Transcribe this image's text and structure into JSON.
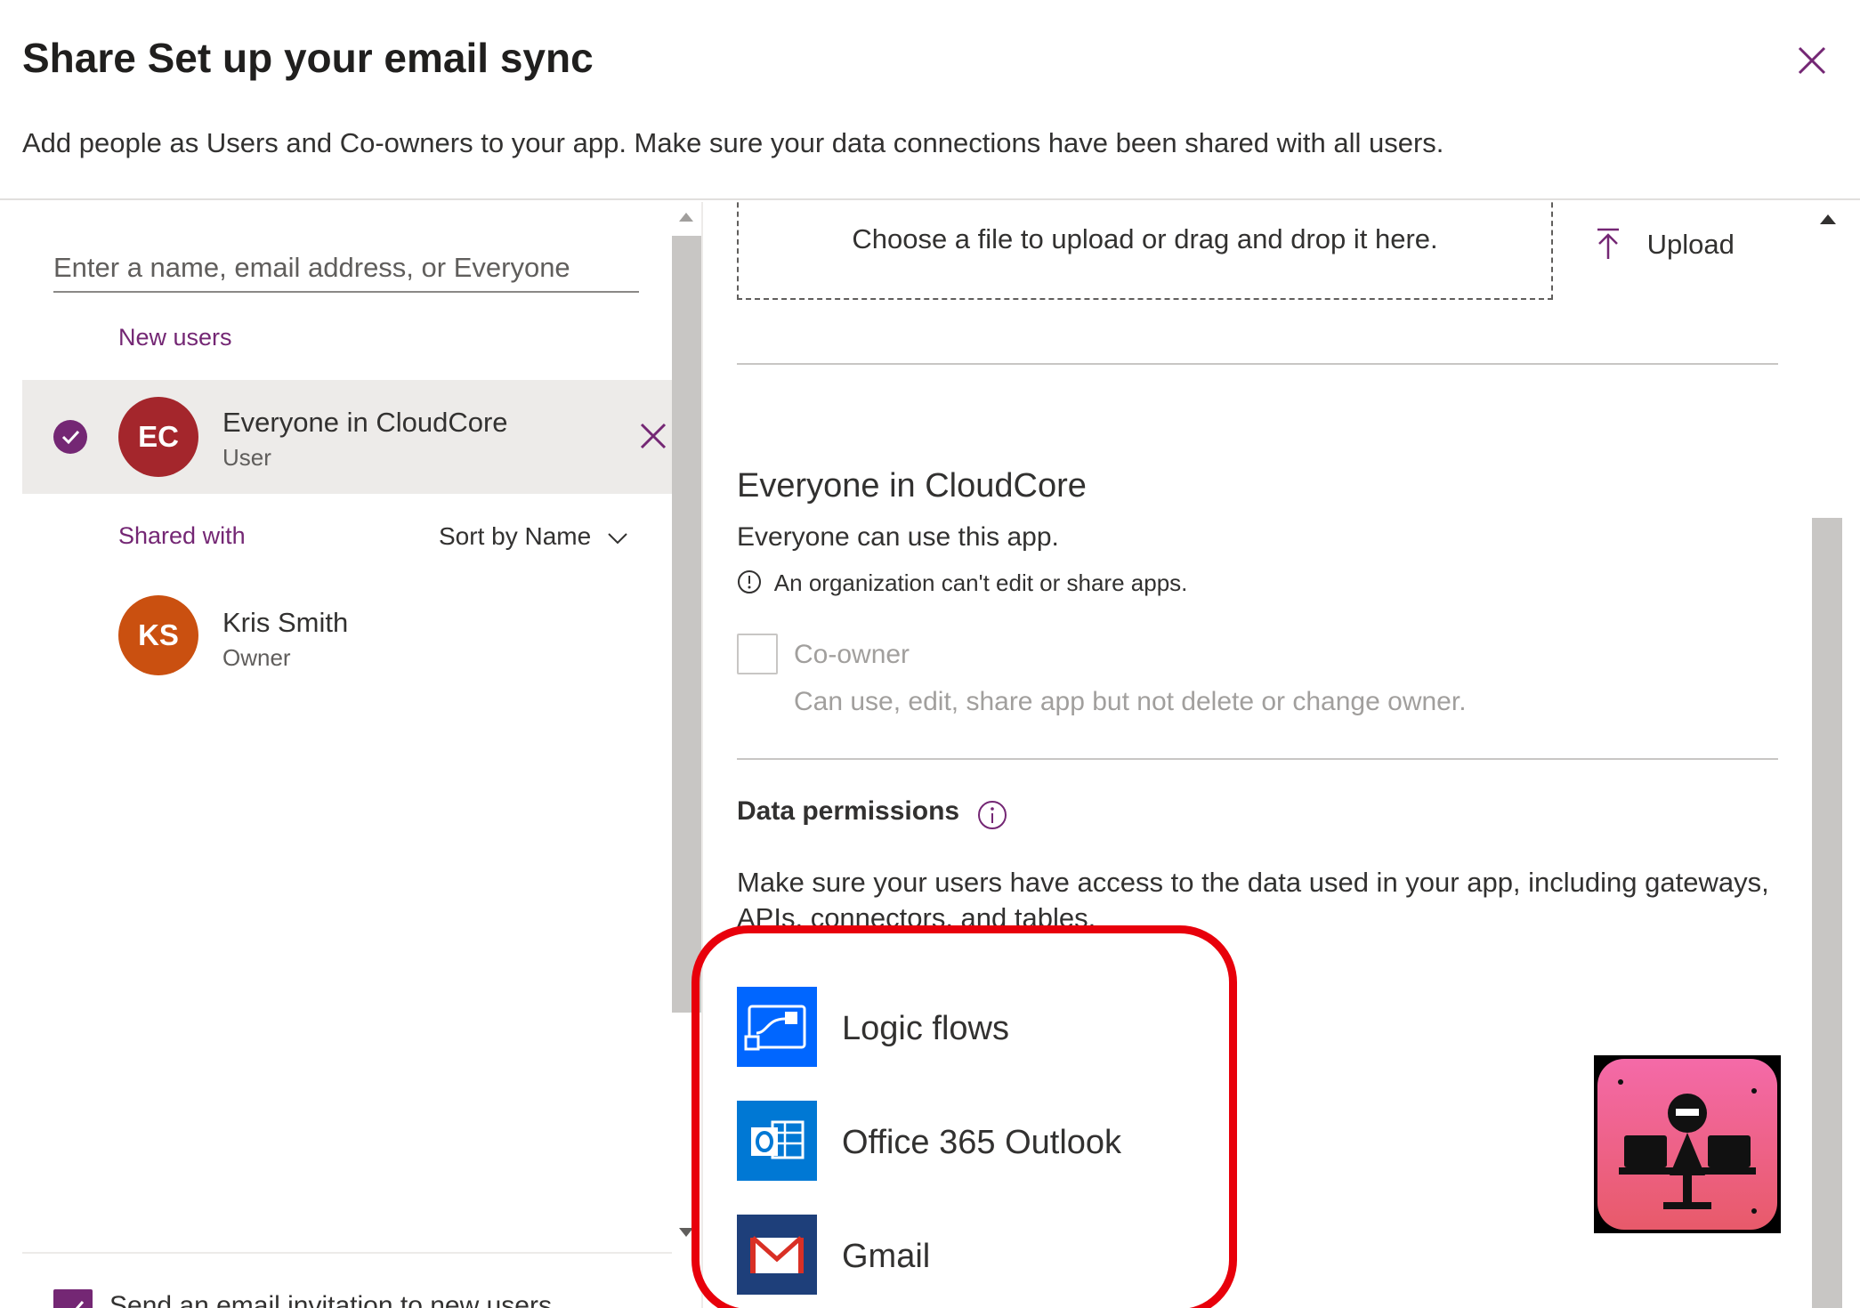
{
  "dialog": {
    "title": "Share Set up your email sync",
    "subtitle": "Add people as Users and Co-owners to your app. Make sure your data connections have been shared with all users.",
    "close_icon": "close-icon"
  },
  "left_pane": {
    "search": {
      "placeholder": "Enter a name, email address, or Everyone",
      "value": ""
    },
    "new_users_label": "New users",
    "new_users": [
      {
        "initials": "EC",
        "name": "Everyone in CloudCore",
        "role": "User",
        "avatar_color": "#a4262c",
        "selected": true
      }
    ],
    "shared_with_label": "Shared with",
    "sort_label": "Sort by Name",
    "shared_with": [
      {
        "initials": "KS",
        "name": "Kris Smith",
        "role": "Owner",
        "avatar_color": "#ca5010"
      }
    ],
    "email_invite_label": "Send an email invitation to new users",
    "email_invite_checked": true
  },
  "right_pane": {
    "dropzone_text": "Choose a file to upload or drag and drop it here.",
    "upload_label": "Upload",
    "group_name": "Everyone in CloudCore",
    "group_desc": "Everyone can use this app.",
    "org_note": "An organization can't edit or share apps.",
    "coowner_label": "Co-owner",
    "coowner_desc": "Can use, edit, share app but not delete or change owner.",
    "coowner_checked": false,
    "data_permissions_title": "Data permissions",
    "data_permissions_desc": "Make sure your users have access to the data used in your app, including gateways, APIs, connectors, and tables.",
    "connections": [
      {
        "name": "Logic flows",
        "icon": "logic-flows-icon",
        "color": "#0066ff"
      },
      {
        "name": "Office 365 Outlook",
        "icon": "outlook-icon",
        "color": "#0078d4"
      },
      {
        "name": "Gmail",
        "icon": "gmail-icon",
        "color": "#1e3f7a"
      }
    ]
  },
  "colors": {
    "accent": "#742774",
    "highlight": "#e8000b",
    "divider": "#c8c6c4"
  }
}
